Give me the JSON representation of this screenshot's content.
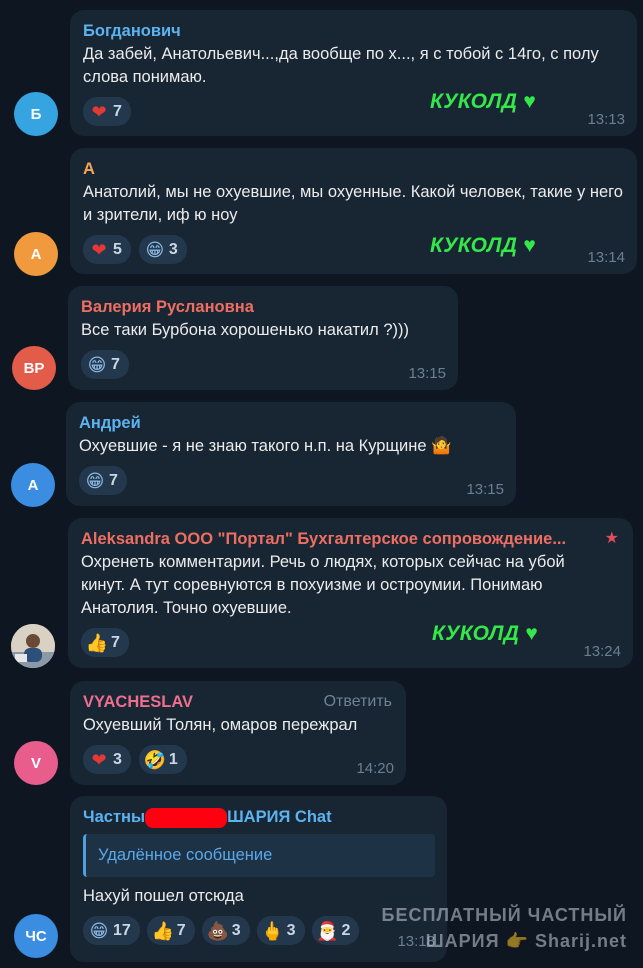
{
  "colors": {
    "background": "#0e1621",
    "bubble": "#182533",
    "tag_green": "#34e84a",
    "time": "#6c7f92"
  },
  "messages": [
    {
      "avatar_text": "Б",
      "avatar_color": "#36a4e0",
      "author": "Богданович",
      "author_color": "#5bb3f0",
      "text": "Да забей, Анатольевич...,да вообще по х..., я с тобой с 14го, с полу слова понимаю.",
      "reactions": [
        {
          "icon": "heart-icon",
          "emoji": "❤️",
          "count": "7"
        }
      ],
      "tag": "КУКОЛД ♥",
      "time": "13:13"
    },
    {
      "avatar_text": "А",
      "avatar_color": "#f09a3d",
      "author": "А",
      "author_color": "#f5a45a",
      "text": "Анатолий, мы не охуевшие, мы охуенные. Какой человек, такие у него и зрители, иф ю ноу",
      "reactions": [
        {
          "icon": "heart-icon",
          "emoji": "❤️",
          "count": "5"
        },
        {
          "icon": "grin-icon",
          "emoji": "😁",
          "count": "3"
        }
      ],
      "tag": "КУКОЛД ♥",
      "time": "13:14"
    },
    {
      "avatar_text": "ВР",
      "avatar_color": "#e35c4a",
      "author": "Валерия Руслановна",
      "author_color": "#ee6e62",
      "text": "Все таки Бурбона хорошенько накатил ?)))",
      "reactions": [
        {
          "icon": "grin-icon",
          "emoji": "😁",
          "count": "7"
        }
      ],
      "time": "13:15"
    },
    {
      "avatar_text": "А",
      "avatar_color": "#3a8de0",
      "author": "Андрей",
      "author_color": "#5bb3f0",
      "text": "Охуевшие - я не знаю такого н.п. на Курщине 🤷",
      "reactions": [
        {
          "icon": "grin-icon",
          "emoji": "😁",
          "count": "7"
        }
      ],
      "time": "13:15"
    },
    {
      "author": "Aleksandra ООО \"Портал\" Бухгалтерское сопровождение...",
      "author_color": "#ee6e62",
      "text": "Охренеть комментарии.  Речь о людях, которых сейчас на убой кинут. А тут соревнуются в похуизме и остроумии. Понимаю Анатолия. Точно охуевшие.",
      "reactions": [
        {
          "icon": "thumbs-up-icon",
          "emoji": "👍",
          "count": "7"
        }
      ],
      "tag": "КУКОЛД ♥",
      "time": "13:24"
    },
    {
      "avatar_text": "V",
      "avatar_color": "#e95d8c",
      "author": "VYACHESLAV",
      "author_color": "#ee6e8e",
      "reply_label": "Ответить",
      "text": "Охуевший Толян, омаров пережрал",
      "reactions": [
        {
          "icon": "heart-icon",
          "emoji": "❤️",
          "count": "3"
        },
        {
          "icon": "rofl-icon",
          "emoji": "🤣",
          "count": "1"
        }
      ],
      "time": "14:20"
    },
    {
      "avatar_text": "ЧС",
      "avatar_color": "#3a8de0",
      "author_prefix": "Частны",
      "author_suffix": "ШАРИЯ Chat",
      "author_color": "#5bb3f0",
      "quote": "Удалённое сообщение",
      "text": "Нахуй пошел отсюда",
      "reactions": [
        {
          "icon": "grin-icon",
          "emoji": "😁",
          "count": "17"
        },
        {
          "icon": "thumbs-up-icon",
          "emoji": "👍",
          "count": "7"
        },
        {
          "icon": "poop-icon",
          "emoji": "💩",
          "count": "3"
        },
        {
          "icon": "middle-finger-icon",
          "emoji": "🖕",
          "count": "3"
        },
        {
          "icon": "santa-icon",
          "emoji": "🎅",
          "count": "2"
        }
      ],
      "time": "13:18"
    }
  ],
  "watermark": {
    "line1": "БЕСПЛАТНЫЙ ЧАСТНЫЙ",
    "line2": "ШАРИЯ 👉 Sharij.net"
  }
}
